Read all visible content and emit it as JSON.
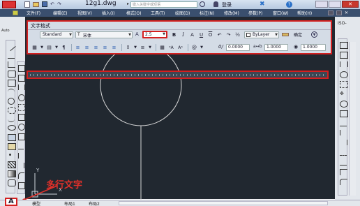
{
  "title_bar": {
    "filename": "12g1.dwg",
    "search_placeholder": "键入关键字或短语",
    "login": "登录"
  },
  "menu": [
    "文件(F)",
    "编辑(E)",
    "视图(V)",
    "插入(I)",
    "格式(O)",
    "工具(T)",
    "绘图(D)",
    "标注(N)",
    "修改(M)",
    "参数(P)",
    "窗口(W)",
    "帮助(H)"
  ],
  "left_panel": {
    "label1": "Auto",
    "label2": "ISO-"
  },
  "text_format": {
    "title": "文字格式",
    "style": "Standard",
    "font": "宋体",
    "height": "2.5",
    "color": "ByLayer",
    "ok": "确定",
    "oblique": "0.0000",
    "tracking": "1.0000",
    "width_factor": "1.0000"
  },
  "annotation": {
    "caption": "多行文字"
  },
  "tabs": [
    "模型",
    "布局1",
    "布局2"
  ],
  "ucs": {
    "y_label": "Y",
    "x_label": "X"
  }
}
